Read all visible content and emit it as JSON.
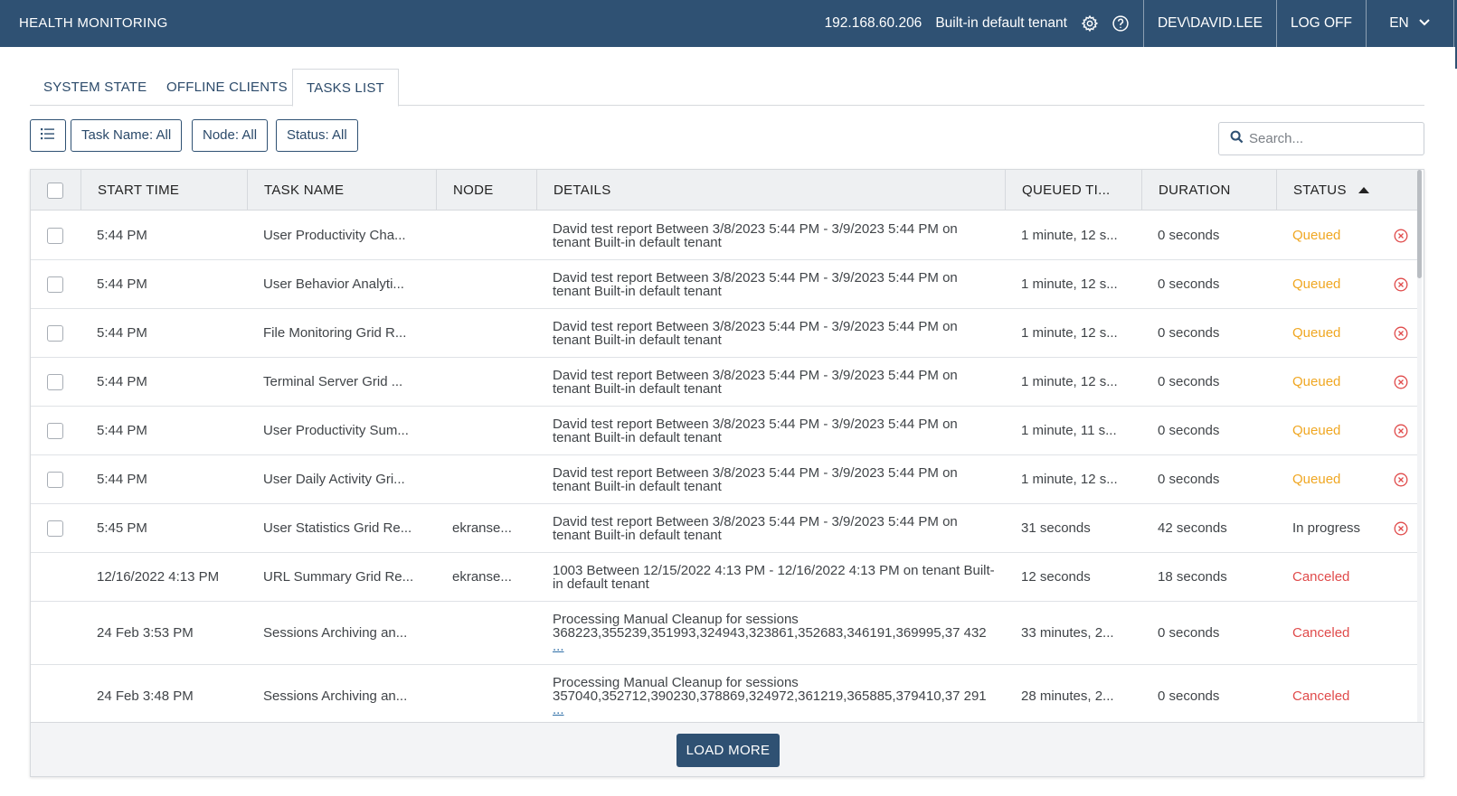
{
  "header": {
    "title": "HEALTH MONITORING",
    "ip": "192.168.60.206",
    "tenant": "Built-in default tenant",
    "user": "DEV\\DAVID.LEE",
    "logoff": "LOG OFF",
    "language": "EN",
    "icons": [
      "gear-icon",
      "help-icon",
      "chevron-down-icon"
    ]
  },
  "tabs": [
    {
      "label": "SYSTEM STATE"
    },
    {
      "label": "OFFLINE CLIENTS"
    },
    {
      "label": "TASKS LIST",
      "active": true
    }
  ],
  "filters": {
    "task_name": "Task Name: All",
    "node": "Node: All",
    "status": "Status: All",
    "search_placeholder": "Search..."
  },
  "table": {
    "columns": [
      "START TIME",
      "TASK NAME",
      "NODE",
      "DETAILS",
      "QUEUED TI...",
      "DURATION",
      "STATUS"
    ],
    "sort_column": "STATUS",
    "sort_dir": "asc",
    "rows": [
      {
        "start": "5:44 PM",
        "task": "User Productivity Cha...",
        "node": "",
        "details": "David test report Between 3/8/2023 5:44 PM - 3/9/2023 5:44 PM on tenant Built-in default tenant",
        "more": "",
        "queued": "1 minute, 12 s...",
        "duration": "0 seconds",
        "status": "Queued",
        "checkbox": true,
        "cancel": true
      },
      {
        "start": "5:44 PM",
        "task": "User Behavior Analyti...",
        "node": "",
        "details": "David test report Between 3/8/2023 5:44 PM - 3/9/2023 5:44 PM on tenant Built-in default tenant",
        "more": "",
        "queued": "1 minute, 12 s...",
        "duration": "0 seconds",
        "status": "Queued",
        "checkbox": true,
        "cancel": true
      },
      {
        "start": "5:44 PM",
        "task": "File Monitoring Grid R...",
        "node": "",
        "details": "David test report Between 3/8/2023 5:44 PM - 3/9/2023 5:44 PM on tenant Built-in default tenant",
        "more": "",
        "queued": "1 minute, 12 s...",
        "duration": "0 seconds",
        "status": "Queued",
        "checkbox": true,
        "cancel": true
      },
      {
        "start": "5:44 PM",
        "task": "Terminal Server Grid ...",
        "node": "",
        "details": "David test report Between 3/8/2023 5:44 PM - 3/9/2023 5:44 PM on tenant Built-in default tenant",
        "more": "",
        "queued": "1 minute, 12 s...",
        "duration": "0 seconds",
        "status": "Queued",
        "checkbox": true,
        "cancel": true
      },
      {
        "start": "5:44 PM",
        "task": "User Productivity Sum...",
        "node": "",
        "details": "David test report Between 3/8/2023 5:44 PM - 3/9/2023 5:44 PM on tenant Built-in default tenant",
        "more": "",
        "queued": "1 minute, 11 s...",
        "duration": "0 seconds",
        "status": "Queued",
        "checkbox": true,
        "cancel": true
      },
      {
        "start": "5:44 PM",
        "task": "User Daily Activity Gri...",
        "node": "",
        "details": "David test report Between 3/8/2023 5:44 PM - 3/9/2023 5:44 PM on tenant Built-in default tenant",
        "more": "",
        "queued": "1 minute, 12 s...",
        "duration": "0 seconds",
        "status": "Queued",
        "checkbox": true,
        "cancel": true
      },
      {
        "start": "5:45 PM",
        "task": "User Statistics Grid Re...",
        "node": "ekranse...",
        "details": "David test report Between 3/8/2023 5:44 PM - 3/9/2023 5:44 PM on tenant Built-in default tenant",
        "more": "",
        "queued": "31 seconds",
        "duration": "42 seconds",
        "status": "In progress",
        "checkbox": true,
        "cancel": true
      },
      {
        "start": "12/16/2022 4:13 PM",
        "task": "URL Summary Grid Re...",
        "node": "ekranse...",
        "details": "1003 Between 12/15/2022 4:13 PM - 12/16/2022 4:13 PM on tenant Built-in default tenant",
        "more": "",
        "queued": "12 seconds",
        "duration": "18 seconds",
        "status": "Canceled",
        "checkbox": false,
        "cancel": false
      },
      {
        "start": "24 Feb 3:53 PM",
        "task": "Sessions Archiving an...",
        "node": "",
        "details": "Processing Manual Cleanup for sessions 368223,355239,351993,324943,323861,352683,346191,369995,37 432",
        "more": "...",
        "queued": "33 minutes, 2...",
        "duration": "0 seconds",
        "status": "Canceled",
        "checkbox": false,
        "cancel": false
      },
      {
        "start": "24 Feb 3:48 PM",
        "task": "Sessions Archiving an...",
        "node": "",
        "details": "Processing Manual Cleanup for sessions 357040,352712,390230,378869,324972,361219,365885,379410,37 291",
        "more": "...",
        "queued": "28 minutes, 2...",
        "duration": "0 seconds",
        "status": "Canceled",
        "checkbox": false,
        "cancel": false
      }
    ]
  },
  "footer": {
    "load_more": "LOAD MORE"
  },
  "colors": {
    "header_bg": "#2f5173",
    "queued": "#f0a722",
    "canceled": "#e04b4b",
    "cancel_icon": "#e04b4b"
  }
}
